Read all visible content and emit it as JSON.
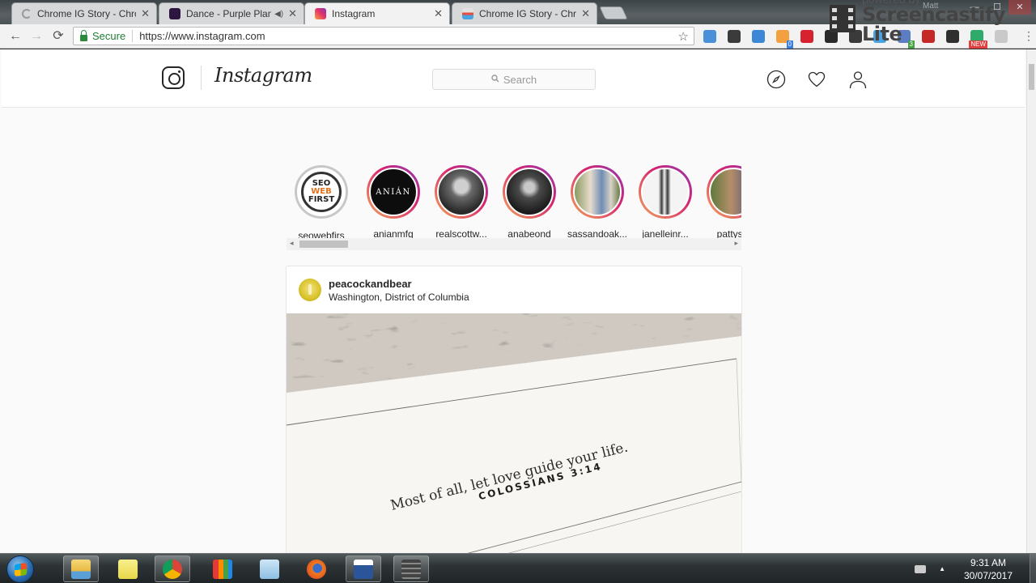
{
  "browser": {
    "tabs": [
      {
        "label": "Chrome IG Story - Chron",
        "icon": "loading-spinner-icon",
        "active": false
      },
      {
        "label": "Dance - Purple Planet",
        "icon": "purple-planet-icon",
        "audio": "speaker-icon",
        "active": false
      },
      {
        "label": "Instagram",
        "icon": "instagram-icon",
        "active": true
      },
      {
        "label": "Chrome IG Story - Chron",
        "icon": "chrome-web-store-icon",
        "active": false
      }
    ],
    "close_glyph": "✕",
    "audio_glyph": "◀)",
    "profile_name": "Matt",
    "window_controls": {
      "minimize": "—",
      "maximize": "☐",
      "close": "✕"
    },
    "nav": {
      "back": "←",
      "forward": "→",
      "reload": "⟳"
    },
    "secure_label": "Secure",
    "url": "https://www.instagram.com",
    "bookmark_glyph": "☆",
    "menu_glyph": "⋮",
    "extensions": [
      {
        "name": "ext-1-icon",
        "color": "#4a90d9"
      },
      {
        "name": "ext-m-icon",
        "color": "#3b3b3b"
      },
      {
        "name": "ext-check-icon",
        "color": "#3a88d6"
      },
      {
        "name": "ext-target-icon",
        "color": "#f2a040",
        "badge": "0",
        "badge_color": "#3b7ddd"
      },
      {
        "name": "pinterest-icon",
        "color": "#d6212f"
      },
      {
        "name": "ext-checklist-icon",
        "color": "#2a2a2a"
      },
      {
        "name": "ext-timer-icon",
        "color": "#3a3a3a"
      },
      {
        "name": "ext-flask-icon",
        "color": "#4aa3df"
      },
      {
        "name": "ext-code-icon",
        "color": "#5b7ec2",
        "badge": "3",
        "badge_color": "#46a046"
      },
      {
        "name": "ext-red-icon",
        "color": "#c62828"
      },
      {
        "name": "buffer-icon",
        "color": "#2f2f2f"
      },
      {
        "name": "ext-new-icon",
        "color": "#2eaa6b",
        "badge": "NEW",
        "badge_color": "#e04040"
      },
      {
        "name": "ext-cursor-icon",
        "color": "#c9c9c9"
      }
    ]
  },
  "overlay": {
    "powered_by": "powered by",
    "brand": "Screencastify Lite"
  },
  "instagram": {
    "wordmark": "Instagram",
    "search_placeholder": "Search",
    "search_icon_glyph": "🔍",
    "stories": [
      {
        "username": "seowebfirs",
        "seen": true,
        "avatar_text": "SEO WEB FIRST"
      },
      {
        "username": "anianmfg",
        "seen": false,
        "avatar_text": "ANIÁN"
      },
      {
        "username": "realscottw...",
        "seen": false
      },
      {
        "username": "anabeond",
        "seen": false
      },
      {
        "username": "sassandoak...",
        "seen": false
      },
      {
        "username": "janelleinr...",
        "seen": false
      },
      {
        "username": "pattyscl",
        "seen": false
      }
    ],
    "post": {
      "username": "peacockandbear",
      "location": "Washington, District of Columbia",
      "image_text_line1": "Most of all, let love guide your life.",
      "image_text_line2": "COLOSSIANS 3:14"
    }
  },
  "taskbar": {
    "apps": [
      {
        "name": "file-explorer-icon",
        "open": true
      },
      {
        "name": "sticky-notes-icon",
        "open": false
      },
      {
        "name": "chrome-icon",
        "open": true
      },
      {
        "name": "avg-antivirus-icon",
        "open": false
      },
      {
        "name": "mail-icon",
        "open": false
      },
      {
        "name": "firefox-icon",
        "open": false
      },
      {
        "name": "word-icon",
        "open": true
      },
      {
        "name": "screencastify-icon",
        "open": true
      }
    ],
    "time": "9:31 AM",
    "date": "30/07/2017"
  }
}
